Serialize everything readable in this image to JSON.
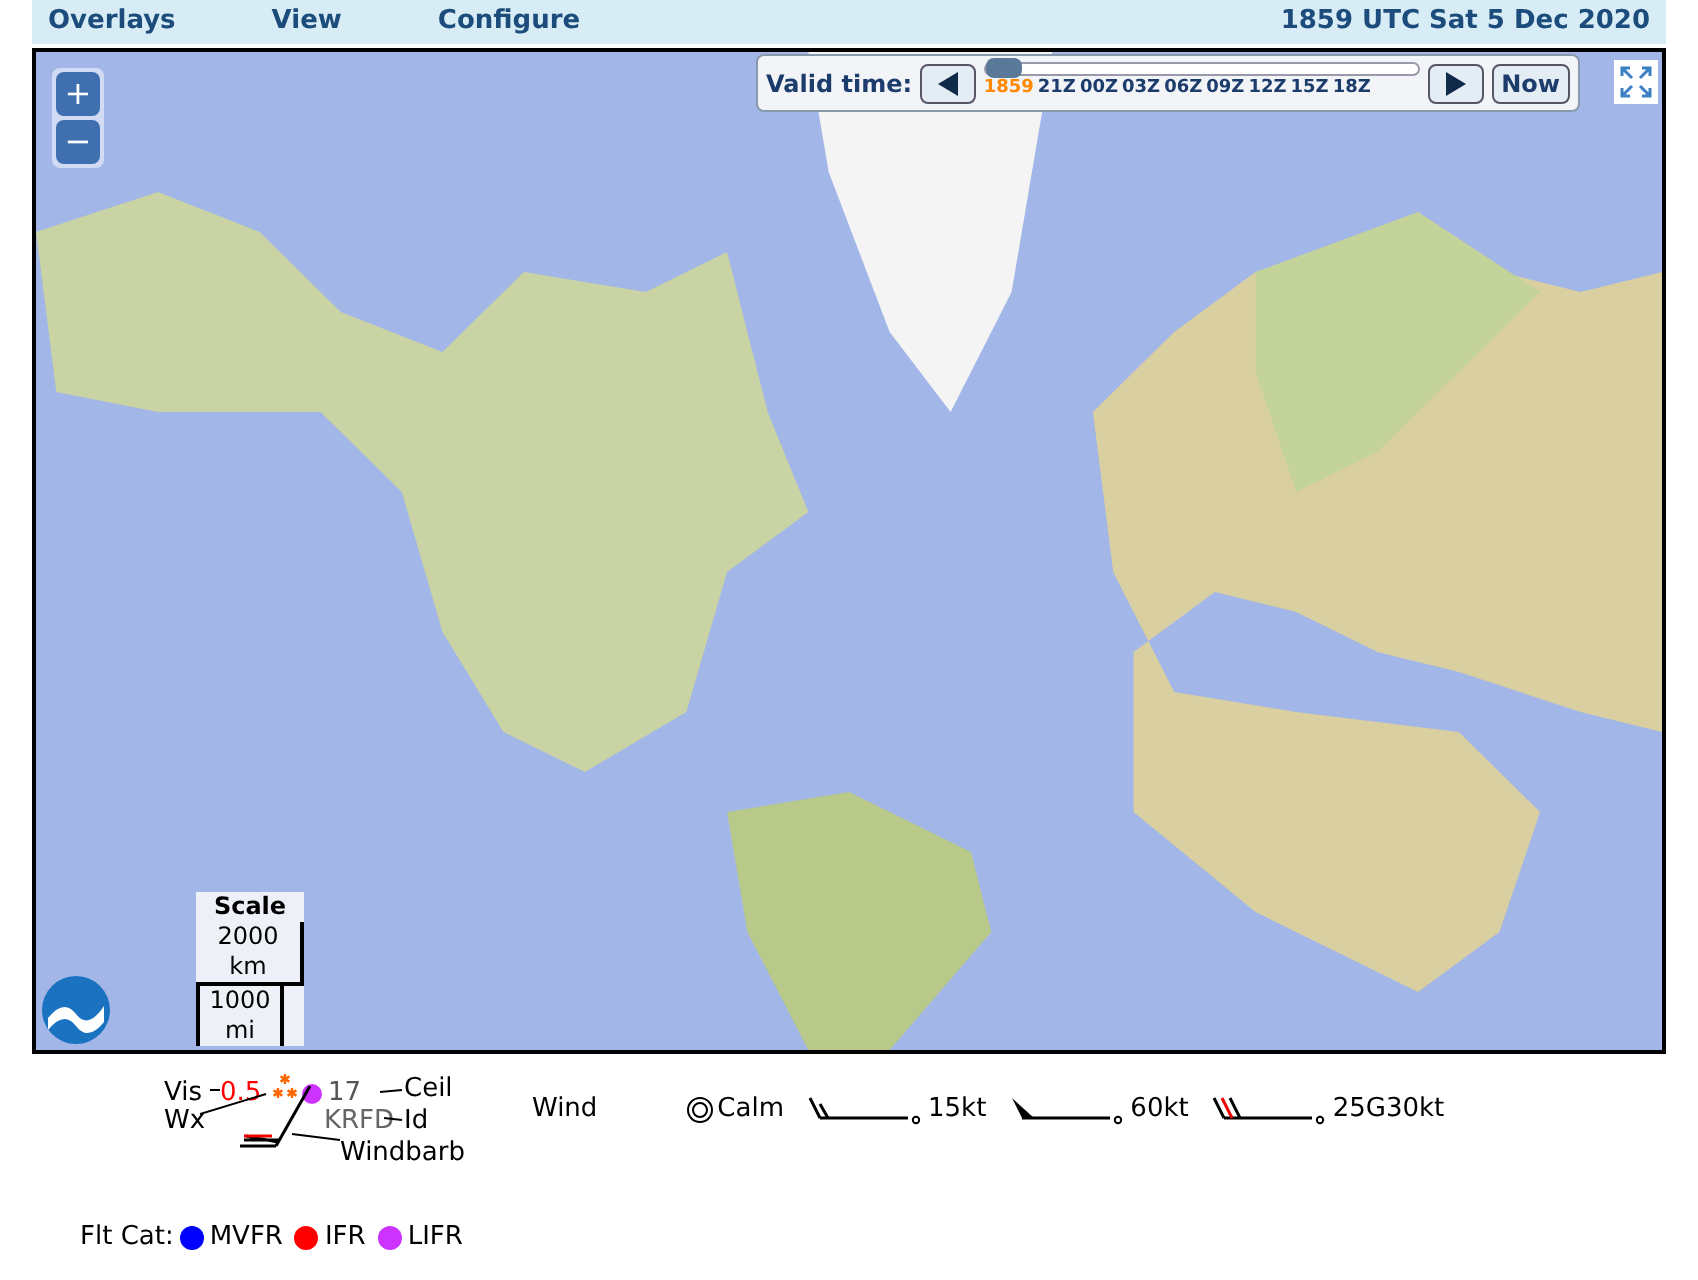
{
  "menu": [
    {
      "label": "Overlays"
    },
    {
      "label": "View"
    },
    {
      "label": "Configure"
    }
  ],
  "time_display": "1859 UTC Sat 5 Dec 2020",
  "time_control": {
    "label": "Valid time:",
    "current": "1859",
    "ticks": [
      "21Z",
      "00Z",
      "03Z",
      "06Z",
      "09Z",
      "12Z",
      "15Z",
      "18Z"
    ],
    "level": 0,
    "now_button": "Now"
  },
  "zoom": {
    "in_label": "+",
    "out_label": "−"
  },
  "scale": {
    "title": "Scale",
    "km_value": "2000",
    "km_unit": "km",
    "mi_value": "1000",
    "mi_unit": "mi"
  },
  "station_model": {
    "vis_label": "Vis",
    "vis_value": "0.5",
    "ceil_value": "17",
    "ceil_label": "Ceil",
    "wx_label": "Wx",
    "id_value": "KRFD",
    "id_label": "Id",
    "windbarb_label": "Windbarb"
  },
  "wind": {
    "title": "Wind",
    "items": [
      {
        "kind": "calm",
        "label": "Calm"
      },
      {
        "kind": "barb",
        "label": "15kt"
      },
      {
        "kind": "pennant",
        "label": "60kt"
      },
      {
        "kind": "gust",
        "label": "25G30kt"
      }
    ]
  },
  "flight_categories": {
    "title": "Flt Cat:",
    "items": [
      {
        "label": "MVFR",
        "color": "#0000ff"
      },
      {
        "label": "IFR",
        "color": "#ff0000"
      },
      {
        "label": "LIFR",
        "color": "#cc33ff"
      }
    ]
  }
}
